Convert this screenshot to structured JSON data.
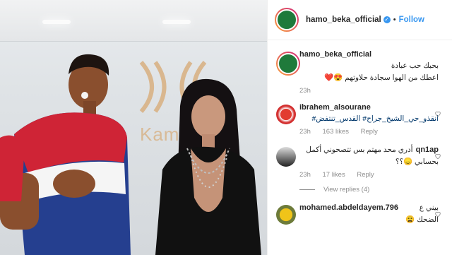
{
  "post": {
    "username": "hamo_beka_official",
    "verified_badge": "✓",
    "separator": "•",
    "follow_label": "Follow"
  },
  "caption": {
    "username": "hamo_beka_official",
    "line1": "بحبك حب عبادة",
    "line2": "اعطك من الهوا سجادة حلاوتهم 😍❤️",
    "time": "23h"
  },
  "comments": [
    {
      "username": "ibrahem_alsourane",
      "text": "انقذو_حي_الشيخ_جراح# القدس_تنتفض#",
      "time": "23h",
      "likes": "163 likes",
      "reply": "Reply"
    },
    {
      "username": "qn1ap",
      "text_line1": "أدري محد مهتم بس تتصحوني أكمل",
      "text_line2": "بحسابي 😞؟؟",
      "time": "23h",
      "likes": "17 likes",
      "reply": "Reply",
      "view_replies": "View replies (4)"
    },
    {
      "username": "mohamed.abdeldayem.796",
      "text_line1": "بيني ع",
      "text_line2": "الضحك 😩"
    }
  ],
  "photo": {
    "studio_logo_text": "Kam"
  },
  "colors": {
    "link": "#3897f0",
    "muted": "#8e8e8e"
  }
}
